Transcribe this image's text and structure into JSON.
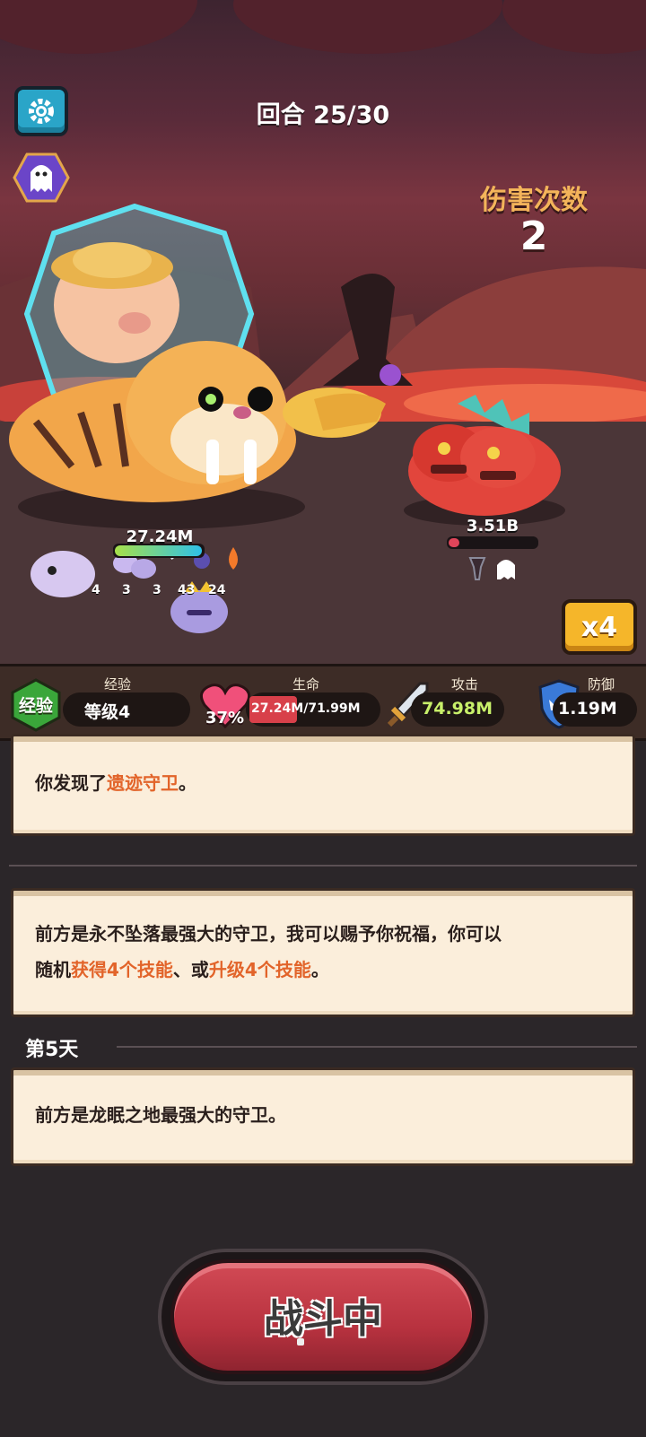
{
  "hud": {
    "round_label": "回合 25/30",
    "damage_count_title": "伤害次数",
    "damage_count_value": "2",
    "speed_label": "x4"
  },
  "player": {
    "hp_text": "27.24M",
    "hp_fraction": 0.37,
    "buff_counts": [
      "4",
      "3",
      "3",
      "43",
      "24"
    ]
  },
  "enemy": {
    "hp_text": "3.51B",
    "hp_fraction": 0.12
  },
  "stats": {
    "xp": {
      "badge": "经验",
      "label": "经验",
      "value": "等级4"
    },
    "life": {
      "label": "生命",
      "percent": "37%",
      "value": "27.24M/71.99M",
      "fraction": 0.37
    },
    "attack": {
      "label": "攻击",
      "value": "74.98M"
    },
    "defense": {
      "label": "防御",
      "value": "1.19M"
    }
  },
  "log": {
    "entry1": {
      "prefix": "你发现了",
      "highlight": "遗迹守卫",
      "suffix": "。"
    },
    "entry2": {
      "line1": "前方是永不坠落最强大的守卫，我可以赐予你祝福，你可以",
      "line2_prefix": "随机",
      "line2_hl1": "获得4个技能",
      "line2_mid": "、或",
      "line2_hl2": "升级4个技能",
      "line2_suffix": "。"
    },
    "day_label": "第5天",
    "entry3": "前方是龙眠之地最强大的守卫。"
  },
  "action": {
    "fight_label": "战斗中"
  },
  "colors": {
    "accent_orange": "#e2642a",
    "damage_title": "#f3b45a",
    "attack_value": "#c8f06a",
    "button_red": "#b8323f",
    "speed_gold": "#f5b62a"
  }
}
